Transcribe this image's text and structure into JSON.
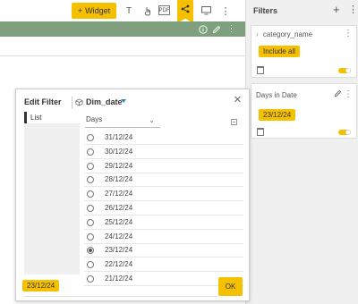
{
  "toolbar": {
    "widget_label": "Widget",
    "widget_plus": "+",
    "text_icon": "T",
    "pdf_label": "PDF",
    "more": "⋮"
  },
  "filters": {
    "title": "Filters",
    "add": "+",
    "more": "⋮",
    "cards": [
      {
        "header": "category_name",
        "chip": "Include all"
      },
      {
        "header": "Days in Date",
        "chip": "23/12/24"
      }
    ]
  },
  "dialog": {
    "title": "Edit Filter",
    "dimension": "Dim_date",
    "close": "✕",
    "list_tab": "List",
    "select_label": "Days",
    "options": [
      "31/12/24",
      "30/12/24",
      "29/12/24",
      "28/12/24",
      "27/12/24",
      "26/12/24",
      "25/12/24",
      "24/12/24",
      "23/12/24",
      "22/12/24",
      "21/12/24"
    ],
    "selected": "23/12/24",
    "bottom_chip": "23/12/24",
    "ok_label": "OK"
  },
  "colors": {
    "accent": "#f5c000",
    "widget_bar": "#7ea07e"
  }
}
